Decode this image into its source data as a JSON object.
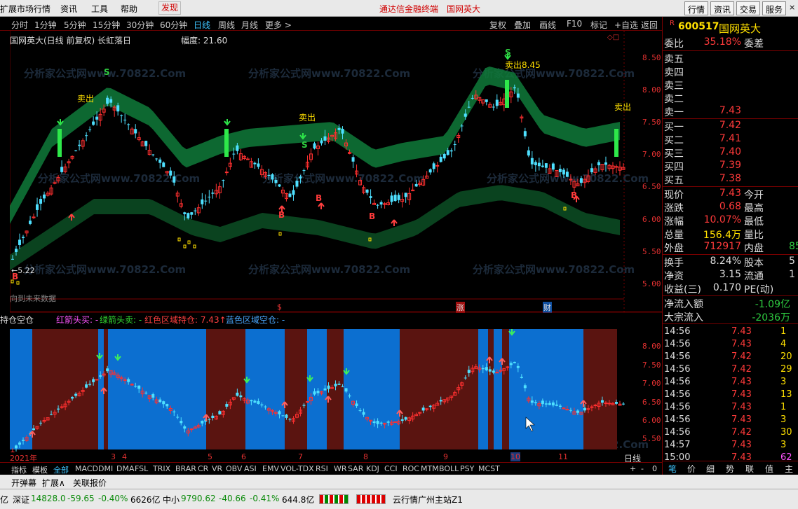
{
  "menu": {
    "items": [
      "扩展市场行情",
      "资讯",
      "工具",
      "帮助"
    ],
    "highlight": "发现",
    "center1": "通达信金融终端",
    "center2": "国网英大",
    "right_buttons": [
      "行情",
      "资讯",
      "交易",
      "服务"
    ]
  },
  "periods": [
    "分时",
    "1分钟",
    "5分钟",
    "15分钟",
    "30分钟",
    "60分钟",
    "日线",
    "周线",
    "月线",
    "更多 >"
  ],
  "selected_period": "日线",
  "toolbar_right": [
    "复权",
    "叠加",
    "画线",
    "F10",
    "标记",
    "+自选",
    "返回"
  ],
  "chart": {
    "title": "国网英大(日线 前复权) 长虹落日",
    "amplitude": "幅度: 21.60",
    "price_axis": [
      "8.50",
      "8.00",
      "7.50",
      "7.00",
      "6.50",
      "6.00",
      "5.50",
      "5.00"
    ],
    "sub_axis": [
      "8.00",
      "7.50",
      "7.00",
      "6.50",
      "6.00",
      "5.50"
    ],
    "labels": {
      "sell1": "卖出",
      "sell2": "卖出",
      "sell3": "卖出8.45",
      "sell4": "卖出",
      "low": "←5.22",
      "future": "向到未来数据"
    },
    "s_marks": [
      "S",
      "S",
      "S",
      "S",
      "S"
    ],
    "b_marks": [
      "B",
      "B",
      "B",
      "B",
      "B"
    ],
    "event_marks": [
      "$",
      "涨",
      "财"
    ],
    "sub_title": "持仓空仓",
    "sub_legend": [
      {
        "text": "红箭头买: -",
        "color": "#ff55ff"
      },
      {
        "text": "绿箭头卖: -",
        "color": "#33dd33"
      },
      {
        "text": "红色区域持仓: 7.43↑",
        "color": "#ff4040"
      },
      {
        "text": "蓝色区域空仓: -",
        "color": "#4aa8ff"
      }
    ],
    "date_labels": [
      "2021年",
      "3",
      "4",
      "5",
      "6",
      "7",
      "8",
      "9",
      "10",
      "11"
    ],
    "period_label": "日线",
    "zoom_controls": [
      "+",
      "-",
      "0"
    ]
  },
  "watermark": "分析家公式网www.70822.Com",
  "quote": {
    "code": "600517",
    "name": "国网英大",
    "tag": "R",
    "wei_bi": {
      "label": "委比",
      "value": "35.18%",
      "label2": "委差"
    },
    "asks": [
      {
        "label": "卖五",
        "price": ""
      },
      {
        "label": "卖四",
        "price": ""
      },
      {
        "label": "卖三",
        "price": ""
      },
      {
        "label": "卖二",
        "price": ""
      },
      {
        "label": "卖一",
        "price": "7.43"
      }
    ],
    "bids": [
      {
        "label": "买一",
        "price": "7.42"
      },
      {
        "label": "买二",
        "price": "7.41"
      },
      {
        "label": "买三",
        "price": "7.40"
      },
      {
        "label": "买四",
        "price": "7.39"
      },
      {
        "label": "买五",
        "price": "7.38"
      }
    ],
    "stats": [
      {
        "l": "现价",
        "v": "7.43",
        "c": "red",
        "l2": "今开"
      },
      {
        "l": "涨跌",
        "v": "0.68",
        "c": "red",
        "l2": "最高"
      },
      {
        "l": "涨幅",
        "v": "10.07%",
        "c": "red",
        "l2": "最低"
      },
      {
        "l": "总量",
        "v": "156.4万",
        "c": "yellow",
        "l2": "量比"
      },
      {
        "l": "外盘",
        "v": "712917",
        "c": "red",
        "l2": "内盘",
        "v2": "85"
      }
    ],
    "stats2": [
      {
        "l": "换手",
        "v": "8.24%",
        "c": "white",
        "l2": "股本",
        "v2": "5"
      },
      {
        "l": "净资",
        "v": "3.15",
        "c": "white",
        "l2": "流通",
        "v2": "1"
      },
      {
        "l": "收益(三)",
        "v": "0.170",
        "c": "white",
        "l2": "PE(动)"
      }
    ],
    "flow": [
      {
        "l": "净流入额",
        "v": "-1.09亿"
      },
      {
        "l": "大宗流入",
        "v": "-2036万"
      }
    ],
    "ticks": [
      {
        "t": "14:56",
        "p": "7.43",
        "v": "1"
      },
      {
        "t": "14:56",
        "p": "7.43",
        "v": "4"
      },
      {
        "t": "14:56",
        "p": "7.42",
        "v": "20"
      },
      {
        "t": "14:56",
        "p": "7.42",
        "v": "29"
      },
      {
        "t": "14:56",
        "p": "7.43",
        "v": "3"
      },
      {
        "t": "14:56",
        "p": "7.43",
        "v": "13"
      },
      {
        "t": "14:56",
        "p": "7.43",
        "v": "1"
      },
      {
        "t": "14:56",
        "p": "7.43",
        "v": "3"
      },
      {
        "t": "14:56",
        "p": "7.42",
        "v": "30"
      },
      {
        "t": "14:57",
        "p": "7.43",
        "v": "3"
      },
      {
        "t": "15:00",
        "p": "7.43",
        "v": "62"
      }
    ],
    "bottom_tabs": [
      "笔",
      "价",
      "细",
      "势",
      "联",
      "值",
      "主"
    ]
  },
  "indicators": [
    "指标",
    "模板",
    "全部",
    "MACD",
    "DMI",
    "DMA",
    "FSL",
    "TRIX",
    "BRAR",
    "CR",
    "VR",
    "OBV",
    "ASI",
    "EMV",
    "VOL-TDX",
    "RSI",
    "WR",
    "SAR",
    "KDJ",
    "CCI",
    "ROC",
    "MTM",
    "BOLL",
    "PSY",
    "MCST"
  ],
  "status": {
    "left": [
      "开弹幕",
      "扩展∧",
      "关联报价"
    ]
  },
  "index": {
    "prefix": "亿",
    "sz_label": "深证",
    "sz_value": "14828.0",
    "sz_change": "-59.65",
    "sz_pct": "-0.40%",
    "sz_amount": "6626亿",
    "zx_label": "中小",
    "zx_value": "9790.62",
    "zx_change": "-40.66",
    "zx_pct": "-0.41%",
    "zx_amount": "644.8亿",
    "station": "云行情广州主站Z1"
  }
}
